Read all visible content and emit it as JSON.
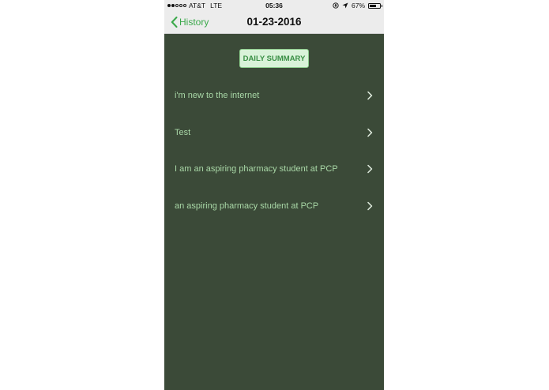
{
  "status_bar": {
    "carrier": "AT&T",
    "network": "LTE",
    "time": "05:36",
    "battery_percent": "67%",
    "battery_level": 0.67,
    "signal_bars_filled": 2,
    "signal_bars_total": 5
  },
  "nav": {
    "back_label": "History",
    "title": "01-23-2016"
  },
  "summary_button_label": "DAILY SUMMARY",
  "entries": [
    {
      "label": "i'm new to the internet"
    },
    {
      "label": "Test"
    },
    {
      "label": "I am an aspiring pharmacy student at PCP"
    },
    {
      "label": "an aspiring pharmacy student at PCP"
    }
  ],
  "colors": {
    "background": "#3b4a38",
    "accent": "#3aa84a",
    "entry_text": "#a9d8a7",
    "summary_bg": "#d9f2d9"
  }
}
